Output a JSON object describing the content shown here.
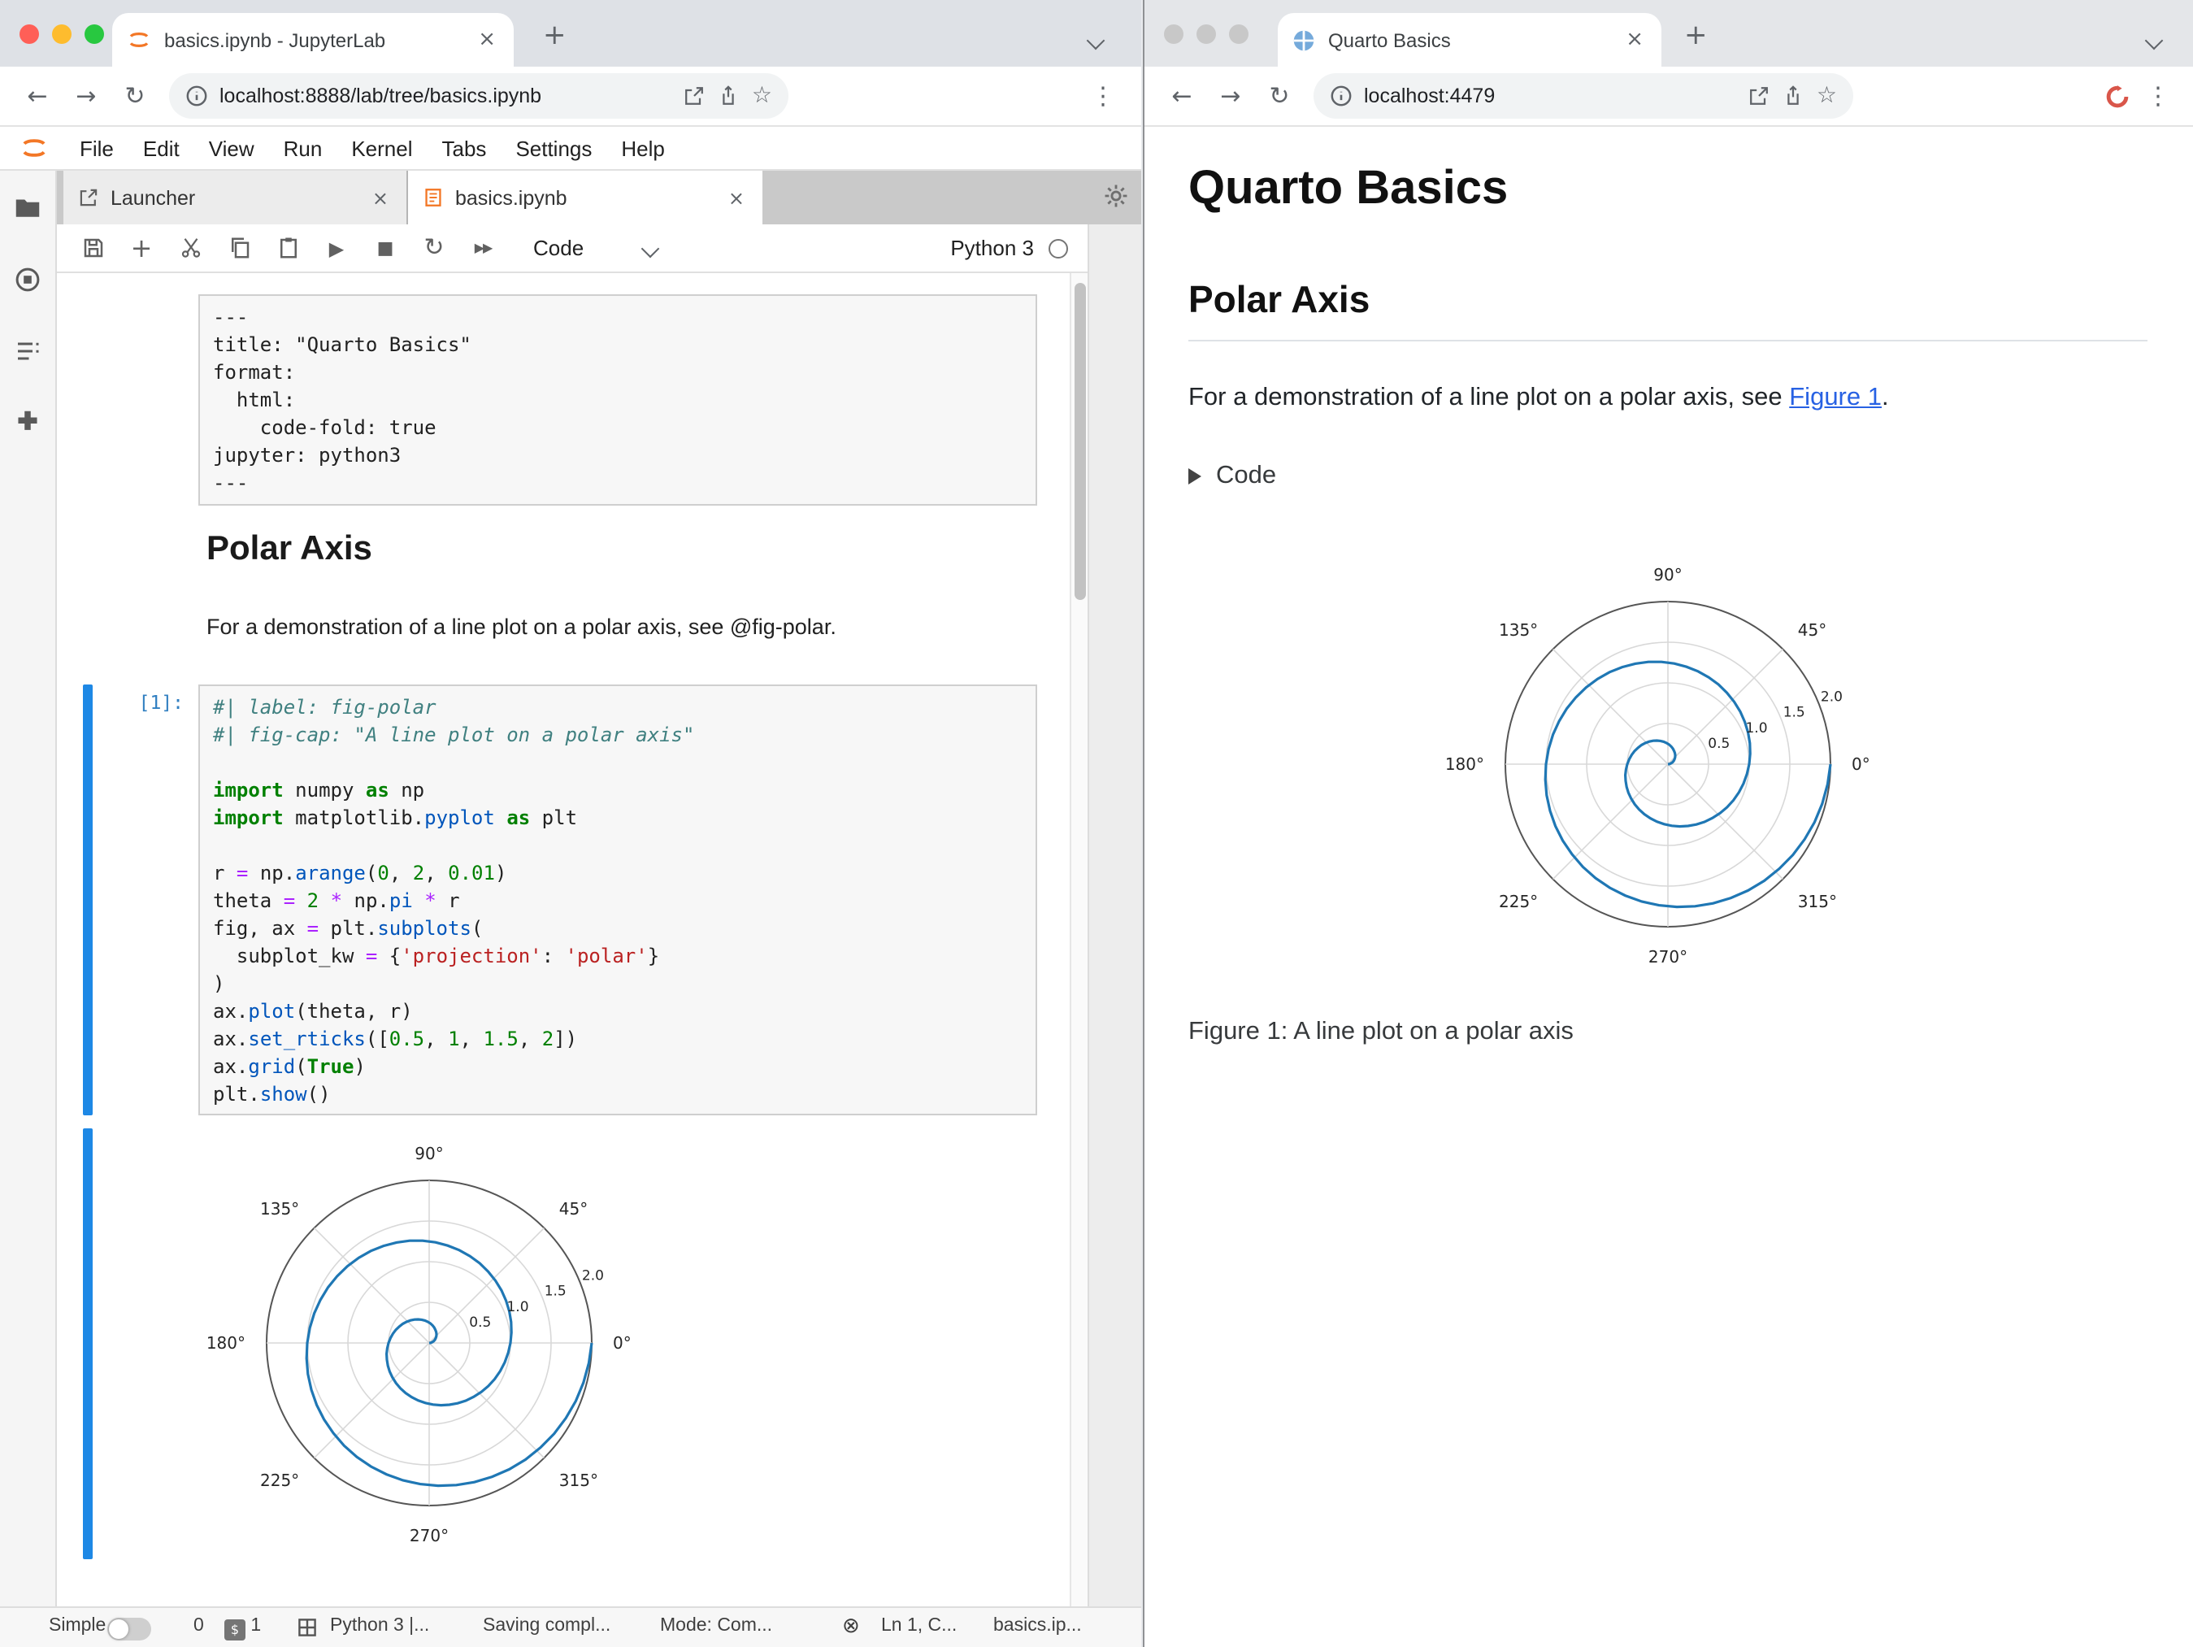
{
  "colors": {
    "spiral_line": "#1f77b4",
    "jupyter_orange": "#f37726",
    "link_blue": "#2761e3",
    "collapser_blue": "#1e88e5"
  },
  "icons": {
    "back": "←",
    "forward": "→",
    "reload": "↻",
    "star": "☆",
    "menu_dots": "⋮",
    "new_tab": "+",
    "close": "×",
    "run": "▶",
    "stop": "■",
    "restart": "↻",
    "fast_forward": "▶▶",
    "error_circle": "⊗",
    "terminal_prompt": "$"
  },
  "left_window": {
    "tab_title": "basics.ipynb - JupyterLab",
    "url": "localhost:8888/lab/tree/basics.ipynb",
    "menu": [
      "File",
      "Edit",
      "View",
      "Run",
      "Kernel",
      "Tabs",
      "Settings",
      "Help"
    ],
    "doc_tabs": {
      "launcher": "Launcher",
      "notebook": "basics.ipynb"
    },
    "nb_toolbar": {
      "cell_type": "Code",
      "kernel_name": "Python 3"
    },
    "raw_cell_lines": [
      "---",
      "title: \"Quarto Basics\"",
      "format:",
      "  html:",
      "    code-fold: true",
      "jupyter: python3",
      "---"
    ],
    "markdown_cell": {
      "heading": "Polar Axis",
      "text": "For a demonstration of a line plot on a polar axis, see @fig-polar."
    },
    "code_cell": {
      "prompt": "[1]:",
      "tokens": [
        [
          [
            "cm",
            "#| label: fig-polar"
          ]
        ],
        [
          [
            "cm",
            "#| fig-cap: \"A line plot on a polar axis\""
          ]
        ],
        [],
        [
          [
            "kw",
            "import"
          ],
          [
            "pl",
            " numpy "
          ],
          [
            "kw",
            "as"
          ],
          [
            "pl",
            " np"
          ]
        ],
        [
          [
            "kw",
            "import"
          ],
          [
            "pl",
            " matplotlib."
          ],
          [
            "fn",
            "pyplot"
          ],
          [
            "pl",
            " "
          ],
          [
            "kw",
            "as"
          ],
          [
            "pl",
            " plt"
          ]
        ],
        [],
        [
          [
            "pl",
            "r "
          ],
          [
            "op",
            "="
          ],
          [
            "pl",
            " np."
          ],
          [
            "fn",
            "arange"
          ],
          [
            "pl",
            "("
          ],
          [
            "num",
            "0"
          ],
          [
            "pl",
            ", "
          ],
          [
            "num",
            "2"
          ],
          [
            "pl",
            ", "
          ],
          [
            "num",
            "0.01"
          ],
          [
            "pl",
            ")"
          ]
        ],
        [
          [
            "pl",
            "theta "
          ],
          [
            "op",
            "="
          ],
          [
            "pl",
            " "
          ],
          [
            "num",
            "2"
          ],
          [
            "pl",
            " "
          ],
          [
            "op",
            "*"
          ],
          [
            "pl",
            " np."
          ],
          [
            "fn",
            "pi"
          ],
          [
            "pl",
            " "
          ],
          [
            "op",
            "*"
          ],
          [
            "pl",
            " r"
          ]
        ],
        [
          [
            "pl",
            "fig, ax "
          ],
          [
            "op",
            "="
          ],
          [
            "pl",
            " plt."
          ],
          [
            "fn",
            "subplots"
          ],
          [
            "pl",
            "("
          ]
        ],
        [
          [
            "pl",
            "  subplot_kw "
          ],
          [
            "op",
            "="
          ],
          [
            "pl",
            " {"
          ],
          [
            "str",
            "'projection'"
          ],
          [
            "pl",
            ": "
          ],
          [
            "str",
            "'polar'"
          ],
          [
            "pl",
            "}"
          ]
        ],
        [
          [
            "pl",
            ")"
          ]
        ],
        [
          [
            "pl",
            "ax."
          ],
          [
            "fn",
            "plot"
          ],
          [
            "pl",
            "(theta, r)"
          ]
        ],
        [
          [
            "pl",
            "ax."
          ],
          [
            "fn",
            "set_rticks"
          ],
          [
            "pl",
            "(["
          ],
          [
            "num",
            "0.5"
          ],
          [
            "pl",
            ", "
          ],
          [
            "num",
            "1"
          ],
          [
            "pl",
            ", "
          ],
          [
            "num",
            "1.5"
          ],
          [
            "pl",
            ", "
          ],
          [
            "num",
            "2"
          ],
          [
            "pl",
            "])"
          ]
        ],
        [
          [
            "pl",
            "ax."
          ],
          [
            "fn",
            "grid"
          ],
          [
            "pl",
            "("
          ],
          [
            "kw",
            "True"
          ],
          [
            "pl",
            ")"
          ]
        ],
        [
          [
            "pl",
            "plt."
          ],
          [
            "fn",
            "show"
          ],
          [
            "pl",
            "()"
          ]
        ]
      ]
    },
    "statusbar": {
      "mode_label": "Simple",
      "notifications": "0",
      "terminals": "1",
      "kernel": "Python 3 |...",
      "saving": "Saving compl...",
      "mode": "Mode: Com...",
      "position": "Ln 1, C...",
      "filename": "basics.ip..."
    }
  },
  "right_window": {
    "tab_title": "Quarto Basics",
    "url": "localhost:4479",
    "page": {
      "title": "Quarto Basics",
      "section_heading": "Polar Axis",
      "paragraph_before_link": "For a demonstration of a line plot on a polar axis, see ",
      "link_text": "Figure 1",
      "paragraph_after_link": ".",
      "code_fold_label": "Code",
      "figure_caption": "Figure 1: A line plot on a polar axis"
    }
  },
  "chart_data": {
    "type": "line",
    "projection": "polar",
    "description": "Spiral line plot: r = arange(0, 2, 0.01), theta = 2*pi*r (two full counterclockwise turns, ending at angle 0° at r=2)",
    "r_ticks": [
      0.5,
      1.0,
      1.5,
      2.0
    ],
    "r_tick_labels": [
      "0.5",
      "1.0",
      "1.5",
      "2.0"
    ],
    "r_max": 2.0,
    "angle_ticks_deg": [
      0,
      45,
      90,
      135,
      180,
      225,
      270,
      315
    ],
    "angle_tick_labels": [
      "0°",
      "45°",
      "90°",
      "135°",
      "180°",
      "225°",
      "270°",
      "315°"
    ],
    "rlabel_angle_deg": 22.5,
    "grid": true,
    "line_color": "#1f77b4"
  }
}
